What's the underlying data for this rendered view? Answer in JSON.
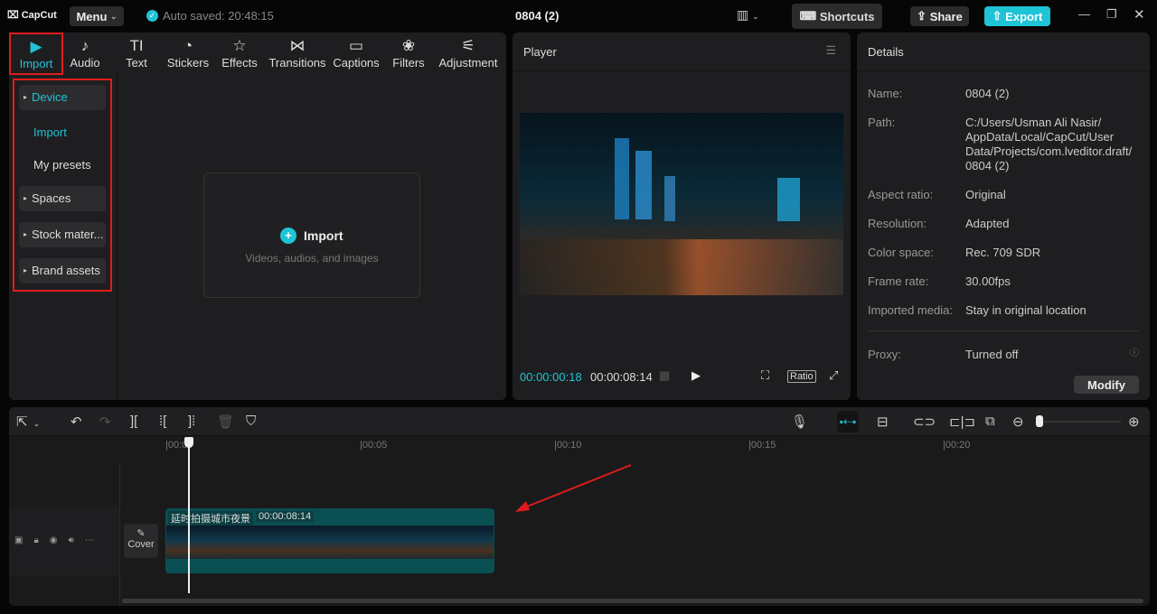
{
  "app": {
    "logo": "CapCut",
    "menu": "Menu",
    "autosave": "Auto saved: 20:48:15",
    "title": "0804 (2)",
    "shortcuts": "Shortcuts",
    "share": "Share",
    "export": "Export"
  },
  "tools": [
    {
      "label": "Import",
      "icon": "▶"
    },
    {
      "label": "Audio",
      "icon": "♪"
    },
    {
      "label": "Text",
      "icon": "TI"
    },
    {
      "label": "Stickers",
      "icon": "◔"
    },
    {
      "label": "Effects",
      "icon": "☆"
    },
    {
      "label": "Transitions",
      "icon": "⋈"
    },
    {
      "label": "Captions",
      "icon": "▭"
    },
    {
      "label": "Filters",
      "icon": "❀"
    },
    {
      "label": "Adjustment",
      "icon": "⚟"
    }
  ],
  "sidebar": {
    "device": "Device",
    "import": "Import",
    "presets": "My presets",
    "spaces": "Spaces",
    "stock": "Stock mater...",
    "brand": "Brand assets"
  },
  "media": {
    "import": "Import",
    "hint": "Videos, audios, and images"
  },
  "player": {
    "title": "Player",
    "current": "00:00:00:18",
    "total": "00:00:08:14",
    "ratio": "Ratio"
  },
  "details": {
    "title": "Details",
    "rows": [
      {
        "label": "Name:",
        "value": "0804 (2)"
      },
      {
        "label": "Path:",
        "value": "C:/Users/Usman Ali Nasir/ AppData/Local/CapCut/User Data/Projects/com.lveditor.draft/ 0804 (2)"
      },
      {
        "label": "Aspect ratio:",
        "value": "Original"
      },
      {
        "label": "Resolution:",
        "value": "Adapted"
      },
      {
        "label": "Color space:",
        "value": "Rec. 709 SDR"
      },
      {
        "label": "Frame rate:",
        "value": "30.00fps"
      },
      {
        "label": "Imported media:",
        "value": "Stay in original location"
      },
      {
        "label": "Proxy:",
        "value": "Turned off"
      }
    ],
    "modify": "Modify"
  },
  "timeline": {
    "ticks": [
      "00:00",
      "00:05",
      "00:10",
      "00:15",
      "00:20"
    ],
    "clip_name": "延时拍摄城市夜景",
    "clip_duration": "00:00:08:14",
    "cover": "Cover"
  },
  "colors": {
    "accent": "#1fc3d6",
    "highlight": "#e01b1b",
    "clip": "#0a4f52"
  }
}
